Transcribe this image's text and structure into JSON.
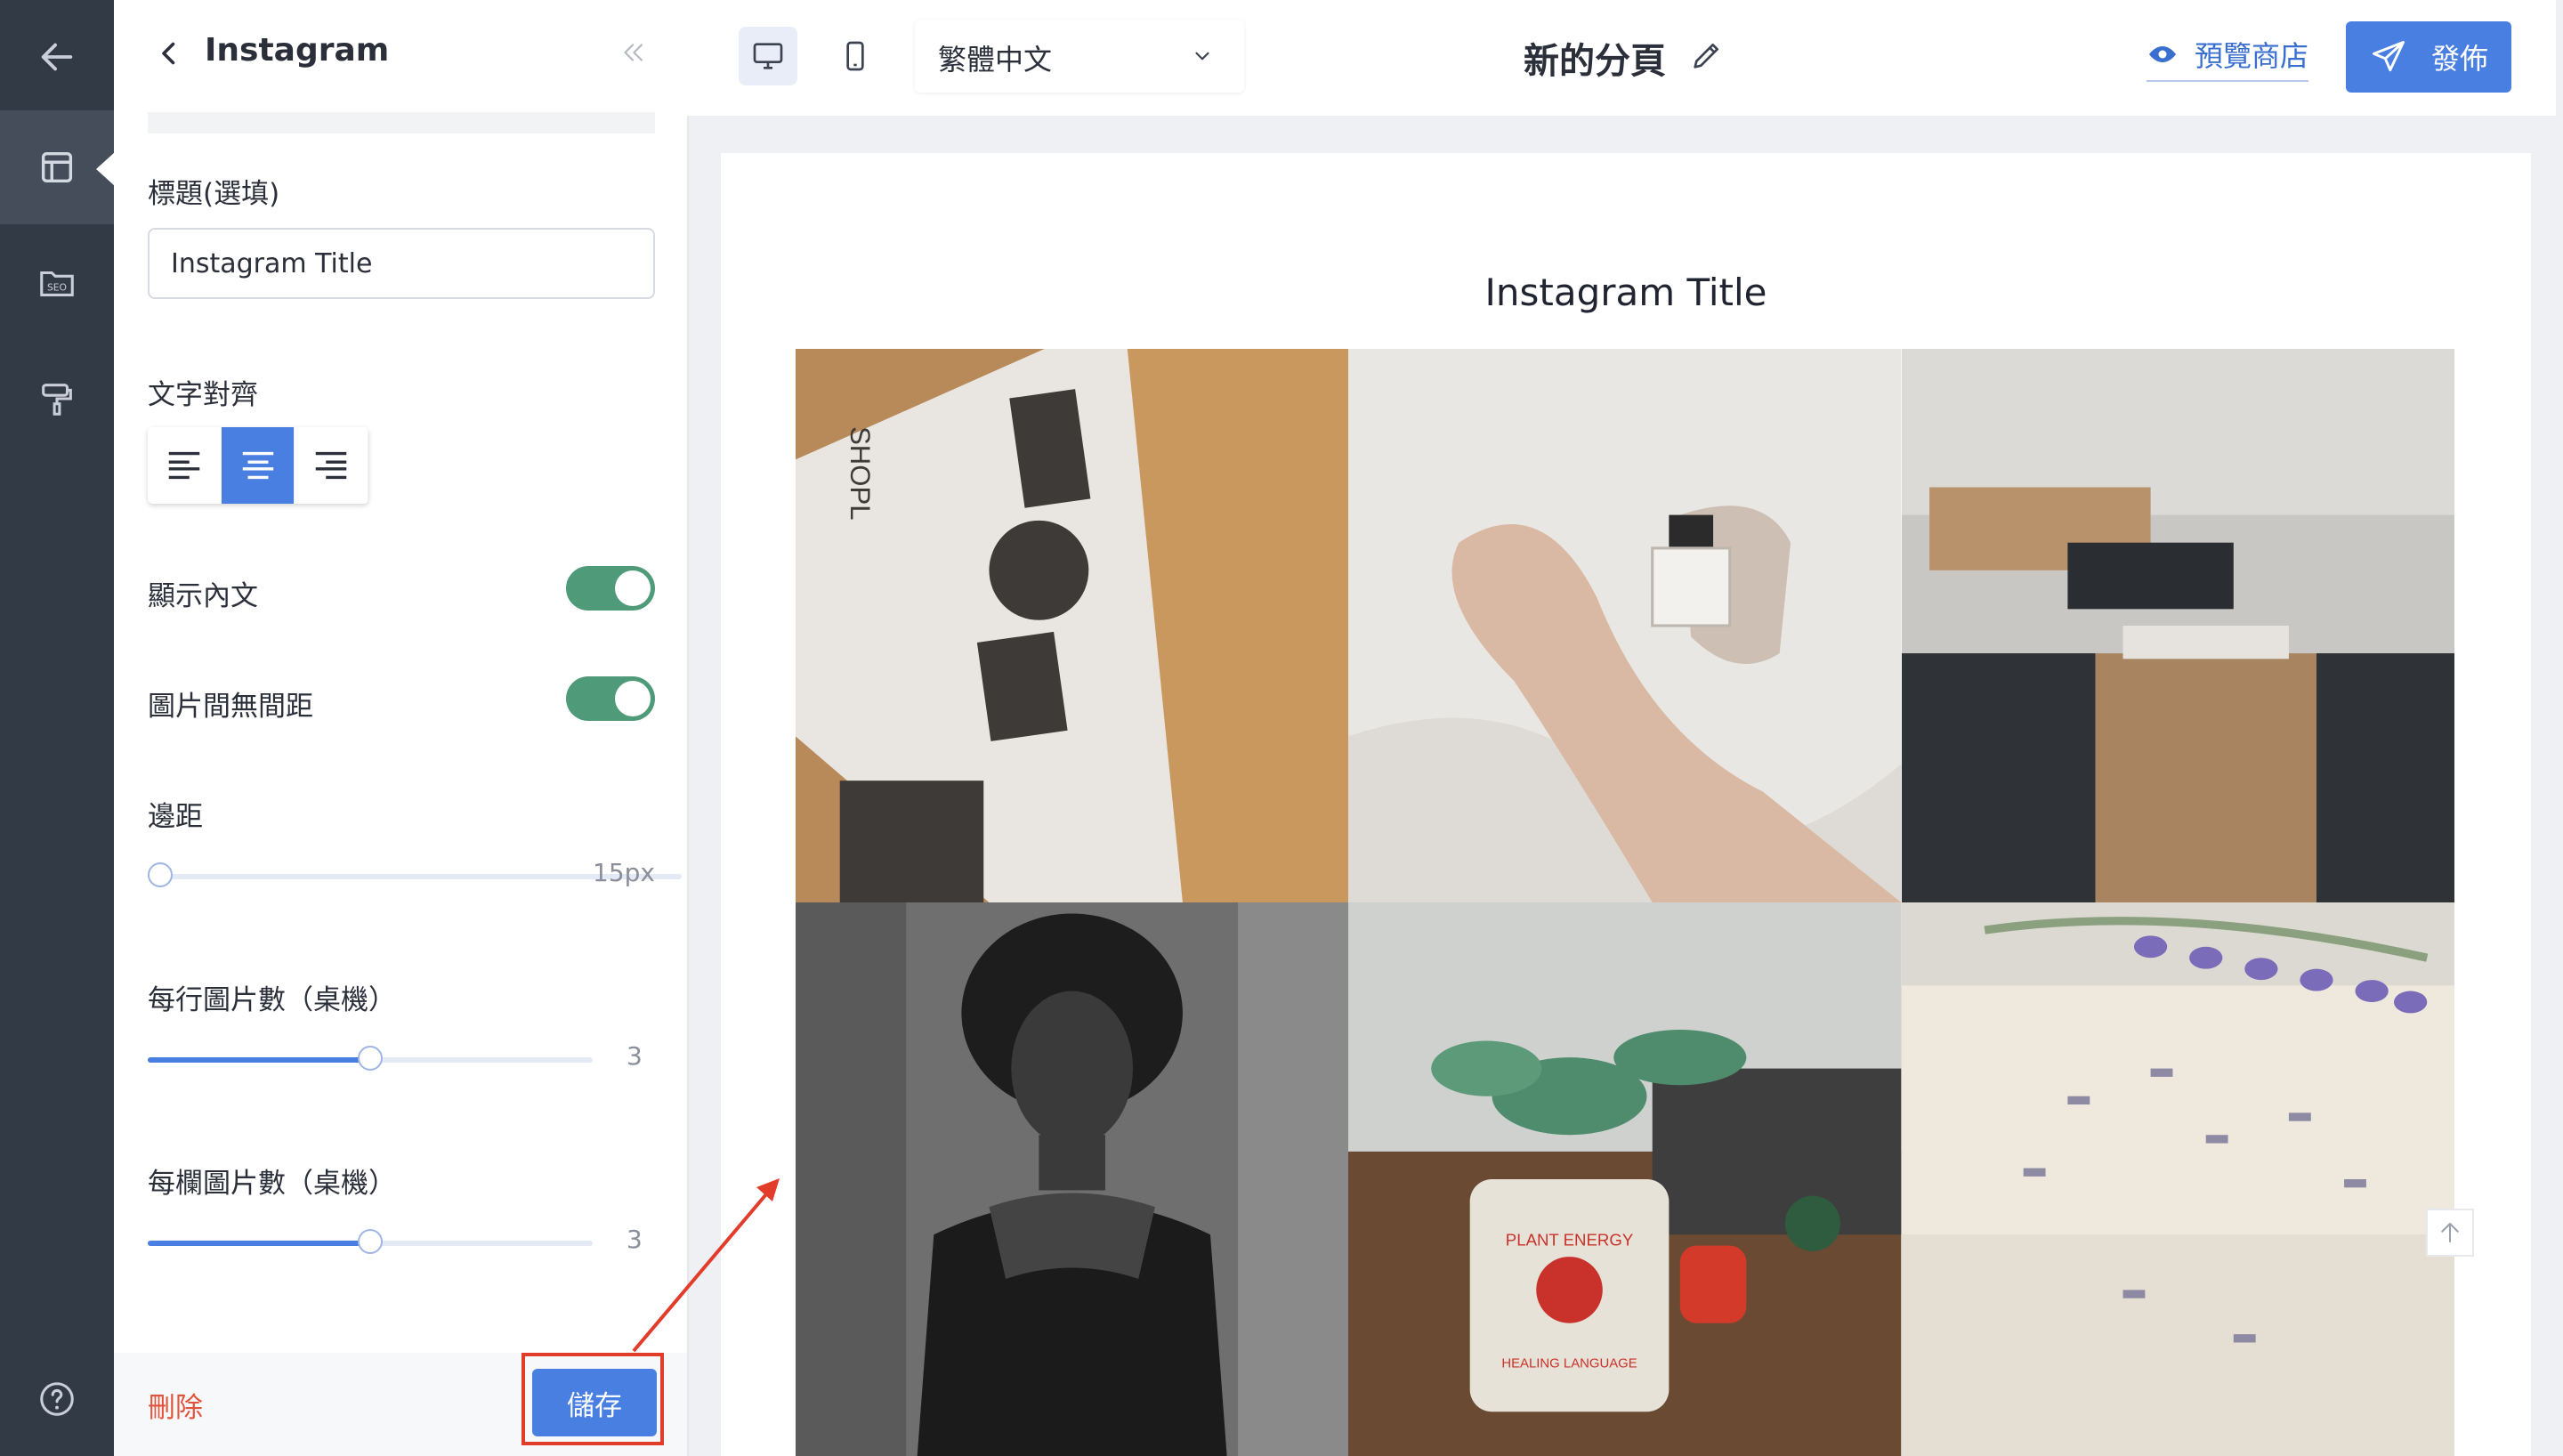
{
  "rail": {
    "items": [
      {
        "icon": "arrow-left-icon"
      },
      {
        "icon": "layout-icon",
        "active": true
      },
      {
        "icon": "seo-folder-icon",
        "badge": "SEO"
      },
      {
        "icon": "paint-roller-icon"
      },
      {
        "icon": "help-icon"
      }
    ]
  },
  "panel": {
    "title": "Instagram",
    "title_field": {
      "label": "標題(選填)",
      "value": "Instagram Title"
    },
    "text_align": {
      "label": "文字對齊",
      "options": [
        "left",
        "center",
        "right"
      ],
      "selected": "center"
    },
    "show_text": {
      "label": "顯示內文",
      "on": true
    },
    "no_gap": {
      "label": "圖片間無間距",
      "on": true
    },
    "padding": {
      "label": "邊距",
      "value": "15px",
      "level": 0
    },
    "per_row": {
      "label": "每行圖片數（桌機）",
      "value": "3",
      "level": 0.5
    },
    "per_col": {
      "label": "每欄圖片數（桌機）",
      "value": "3",
      "level": 0.5
    },
    "delete_label": "刪除",
    "save_label": "儲存"
  },
  "topbar": {
    "language": "繁體中文",
    "page_name": "新的分頁",
    "preview_label": "預覽商店",
    "publish_label": "發佈"
  },
  "canvas": {
    "title": "Instagram Title",
    "tiles": [
      {
        "name": "tile-shopline-banner"
      },
      {
        "name": "tile-perfume-hands"
      },
      {
        "name": "tile-office"
      },
      {
        "name": "tile-portrait"
      },
      {
        "name": "tile-plant-energy"
      },
      {
        "name": "tile-lavender-soap"
      }
    ],
    "tile_texts": {
      "plant_label_1": "PLANT ENERGY",
      "plant_label_2": "HEALING LANGUAGE",
      "banner_text": "SHOPL"
    }
  },
  "colors": {
    "accent": "#4a7fe2",
    "toggle_on": "#4f9a78",
    "danger": "#e2533b",
    "annotation": "#e23c2a",
    "rail_bg": "#323a46"
  }
}
